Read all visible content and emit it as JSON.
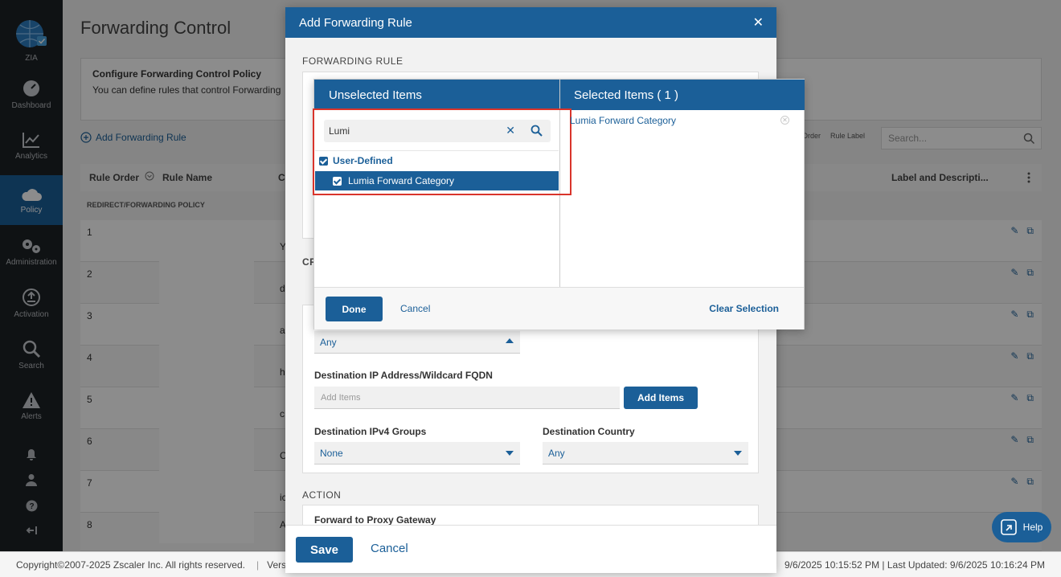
{
  "sidebar": {
    "brand": "ZIA",
    "items": [
      {
        "label": "Dashboard",
        "icon": "dashboard-icon"
      },
      {
        "label": "Analytics",
        "icon": "analytics-icon"
      },
      {
        "label": "Policy",
        "icon": "cloud-icon"
      },
      {
        "label": "Administration",
        "icon": "gears-icon"
      },
      {
        "label": "Activation",
        "icon": "activation-icon"
      },
      {
        "label": "Search",
        "icon": "search-icon"
      },
      {
        "label": "Alerts",
        "icon": "alert-icon"
      }
    ]
  },
  "page": {
    "title": "Forwarding Control",
    "config_title": "Configure Forwarding Control Policy",
    "config_sub": "You can define rules that control Forwarding",
    "add_rule": "Add Forwarding Rule",
    "toolbar": {
      "order": "Order",
      "rule_label": "Rule Label"
    },
    "search_placeholder": "Search...",
    "columns": {
      "rule_order": "Rule Order",
      "rule_name": "Rule Name",
      "c": "C",
      "label_desc": "Label and Descripti..."
    },
    "section": "REDIRECT/FORWARDING POLICY",
    "rows": [
      {
        "num": "1",
        "text": "Y"
      },
      {
        "num": "2",
        "text": "d"
      },
      {
        "num": "3",
        "text": "a"
      },
      {
        "num": "4",
        "text": "h"
      },
      {
        "num": "5",
        "text": "c"
      },
      {
        "num": "6",
        "text": "C"
      },
      {
        "num": "7",
        "text": "ic"
      },
      {
        "num": "8",
        "text": "A"
      }
    ]
  },
  "footer": {
    "copyright": "Copyright©2007-2025 Zscaler Inc. All rights reserved.",
    "version": "Versi",
    "times": "9/6/2025 10:15:52 PM  |  Last Updated: 9/6/2025 10:16:24 PM"
  },
  "modal": {
    "title": "Add Forwarding Rule",
    "section_forwarding": "FORWARDING RULE",
    "section_cr": "CR",
    "any_select": "Any",
    "dest_ip_label": "Destination IP Address/Wildcard FQDN",
    "dest_ip_placeholder": "Add Items",
    "add_items": "Add Items",
    "dest_groups_label": "Destination IPv4 Groups",
    "dest_groups_value": "None",
    "dest_country_label": "Destination Country",
    "dest_country_value": "Any",
    "section_action": "ACTION",
    "forward_label": "Forward to Proxy Gateway",
    "save": "Save",
    "cancel": "Cancel"
  },
  "picker": {
    "unselected_title": "Unselected Items",
    "selected_title": "Selected Items ( 1 )",
    "search_value": "Lumi",
    "group": "User-Defined",
    "item": "Lumia Forward Category",
    "selected_item": "Lumia Forward Category",
    "done": "Done",
    "cancel": "Cancel",
    "clear": "Clear Selection"
  },
  "help": "Help"
}
